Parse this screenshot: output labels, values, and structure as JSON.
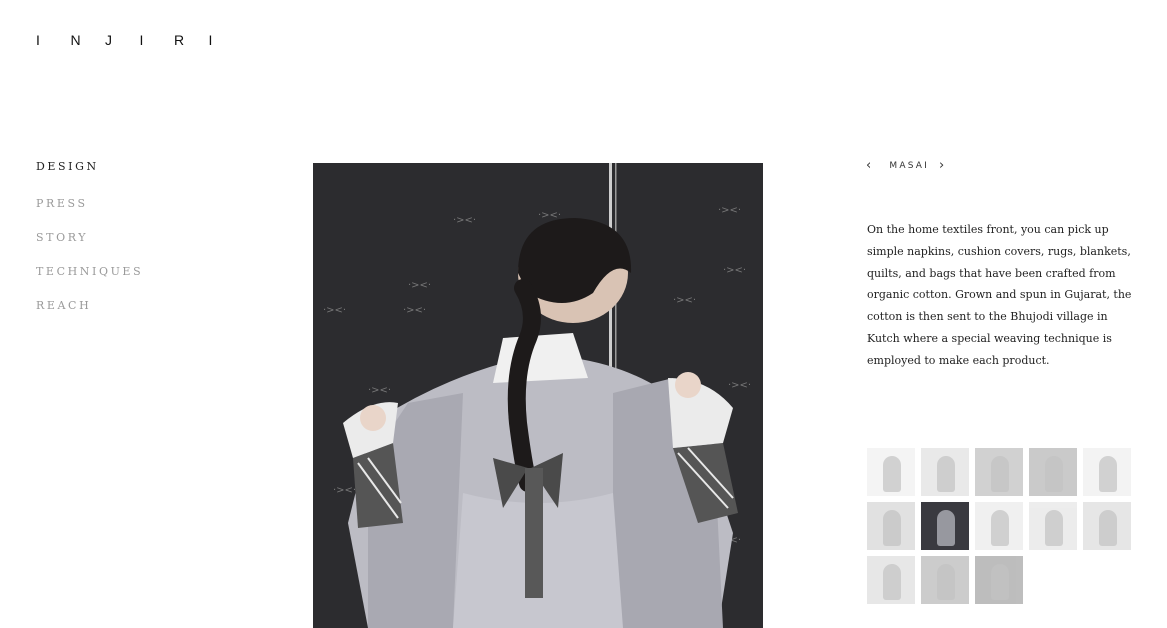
{
  "brand": {
    "logo_letters": [
      "I",
      "N",
      "J",
      "I",
      "R",
      "I"
    ]
  },
  "nav": {
    "items": [
      {
        "label": "DESIGN",
        "active": true
      },
      {
        "label": "PRESS",
        "active": false
      },
      {
        "label": "STORY",
        "active": false
      },
      {
        "label": "TECHNIQUES",
        "active": false
      },
      {
        "label": "REACH",
        "active": false
      }
    ]
  },
  "hero": {
    "icon": "photo-woman-in-jacket"
  },
  "collection": {
    "title": "MASAI",
    "prev_icon": "chevron-left-icon",
    "next_icon": "chevron-right-icon"
  },
  "description": "On the home textiles front, you can pick up simple napkins, cushion covers, rugs, blankets, quilts, and bags that have been crafted from organic cotton. Grown and spun in Gujarat, the cotton is then sent to the Bhujodi village in Kutch where a special weaving technique is employed to make each product.",
  "thumbnails": {
    "count": 13,
    "active_index": 6,
    "colors": [
      "#e8e8e8",
      "#cfcfcf",
      "#9a9a9a",
      "#8c8c8c",
      "#e6e6e6",
      "#bdbdbd",
      "#3a3a40",
      "#dedede",
      "#d6d6d6",
      "#c8c8c8",
      "#cbcbcb",
      "#8f8f8f",
      "#6e6e6e"
    ]
  }
}
